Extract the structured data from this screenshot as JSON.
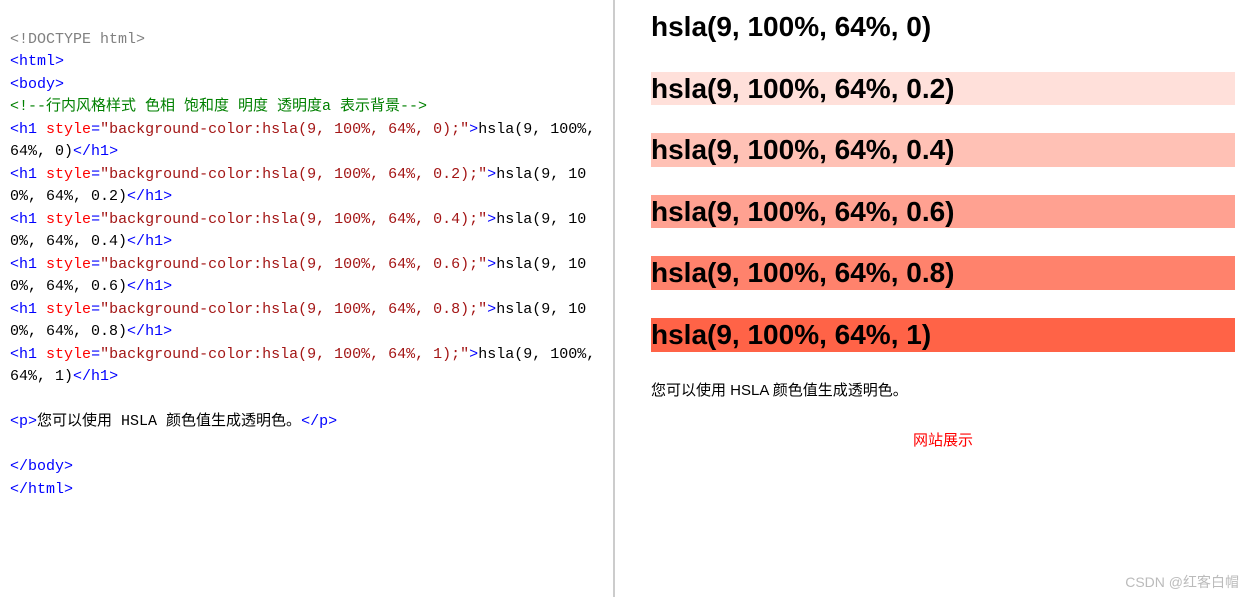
{
  "code": {
    "doctype": "<!DOCTYPE html>",
    "html_open": "html",
    "body_open": "body",
    "comment_open": "<!--",
    "comment_text": "行内风格样式 色相 饱和度 明度 透明度a 表示背景",
    "comment_close": "-->",
    "style_attr": "style",
    "lines": [
      {
        "style_val": "background-color:hsla(9, 100%, 64%, 0);",
        "inner": "hsla(9, 100%, 64%, 0)"
      },
      {
        "style_val": "background-color:hsla(9, 100%, 64%, 0.2);",
        "inner": "hsla(9, 100%, 64%, 0.2)"
      },
      {
        "style_val": "background-color:hsla(9, 100%, 64%, 0.4);",
        "inner": "hsla(9, 100%, 64%, 0.4)"
      },
      {
        "style_val": "background-color:hsla(9, 100%, 64%, 0.6);",
        "inner": "hsla(9, 100%, 64%, 0.6)"
      },
      {
        "style_val": "background-color:hsla(9, 100%, 64%, 0.8);",
        "inner": "hsla(9, 100%, 64%, 0.8)"
      },
      {
        "style_val": "background-color:hsla(9, 100%, 64%, 1);",
        "inner": "hsla(9, 100%, 64%, 1)"
      }
    ],
    "p_inner": "您可以使用 HSLA 颜色值生成透明色。",
    "body_close": "body",
    "html_close": "html",
    "lt": "<",
    "gt": ">",
    "slash": "/",
    "eq": "=",
    "h1": "h1",
    "p": "p",
    "quote": "\""
  },
  "preview": {
    "headings": [
      {
        "text": "hsla(9, 100%, 64%, 0)",
        "bg": "hsla(9,100%,64%,0)"
      },
      {
        "text": "hsla(9, 100%, 64%, 0.2)",
        "bg": "hsla(9,100%,64%,0.2)"
      },
      {
        "text": "hsla(9, 100%, 64%, 0.4)",
        "bg": "hsla(9,100%,64%,0.4)"
      },
      {
        "text": "hsla(9, 100%, 64%, 0.6)",
        "bg": "hsla(9,100%,64%,0.6)"
      },
      {
        "text": "hsla(9, 100%, 64%, 0.8)",
        "bg": "hsla(9,100%,64%,0.8)"
      },
      {
        "text": "hsla(9, 100%, 64%, 1)",
        "bg": "hsla(9,100%,64%,1)"
      }
    ],
    "paragraph": "您可以使用 HSLA 颜色值生成透明色。",
    "site_label": "网站展示"
  },
  "watermark": "CSDN @红客白帽"
}
